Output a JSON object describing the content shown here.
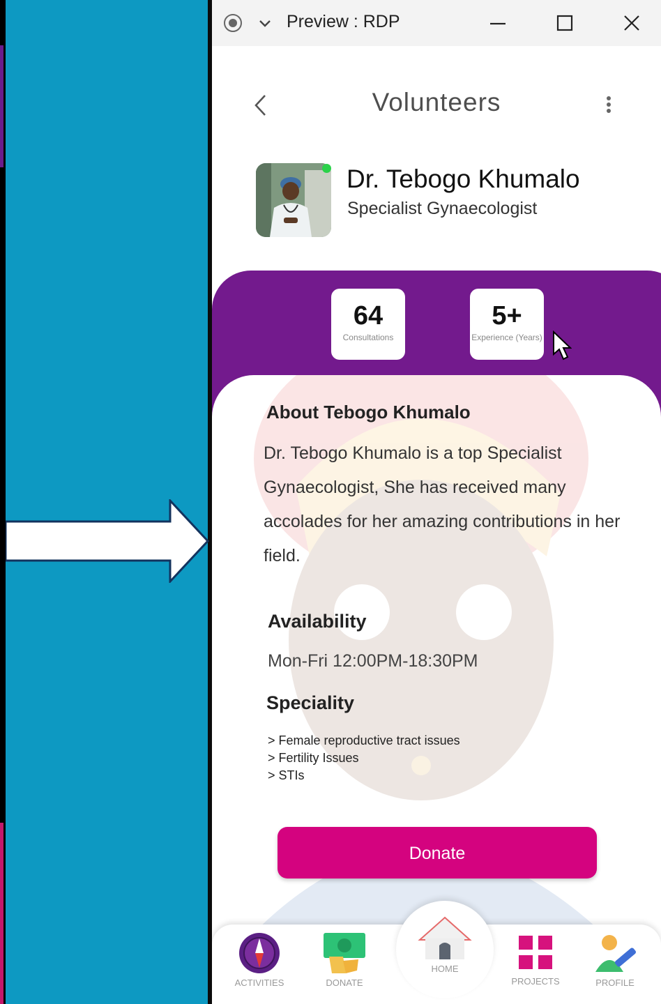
{
  "window": {
    "title": "Preview : RDP"
  },
  "header": {
    "title": "Volunteers"
  },
  "profile": {
    "name": "Dr. Tebogo Khumalo",
    "role": "Specialist Gynaecologist"
  },
  "stats": [
    {
      "value": "64",
      "label": "Consultations"
    },
    {
      "value": "5+",
      "label": "Experience (Years)"
    }
  ],
  "about": {
    "title": "About Tebogo Khumalo",
    "text": "Dr. Tebogo Khumalo is a top Specialist Gynaecologist, She has received many accolades for her amazing contributions in her field."
  },
  "availability": {
    "title": "Availability",
    "text": "Mon-Fri 12:00PM-18:30PM"
  },
  "speciality": {
    "title": "Speciality",
    "items": [
      "> Female reproductive tract issues",
      "> Fertility Issues",
      "> STIs"
    ]
  },
  "donate_button": {
    "label": "Donate"
  },
  "nav": {
    "activities": "ACTIVITIES",
    "donate": "DONATE",
    "home": "HOME",
    "projects": "PROJECTS",
    "profile": "PROFILE"
  },
  "colors": {
    "left_pane": "#0d99c2",
    "purple_band": "#731a8d",
    "donate_button": "#d4037f",
    "online": "#2bd24a"
  }
}
